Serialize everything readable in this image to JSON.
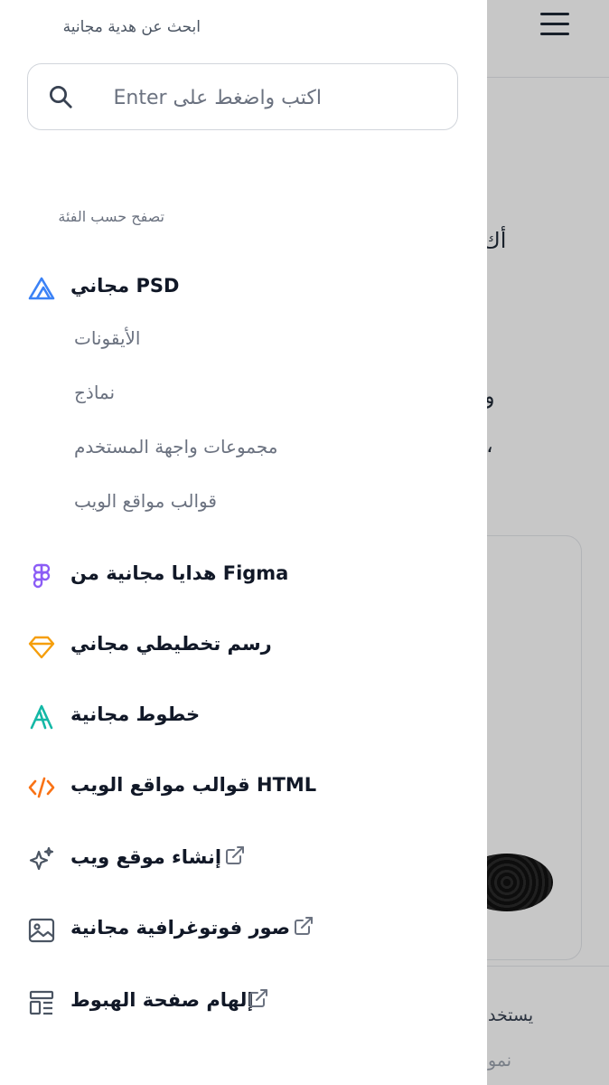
{
  "background": {
    "menu_label": "menu",
    "text_1": "أك",
    "text_2": "و",
    "text_3": "،",
    "footer_text_1": "يستخد",
    "footer_text_2": "نمو"
  },
  "drawer": {
    "title": "ابحث عن هدية مجانية",
    "search": {
      "placeholder": "اكتب واضغط على Enter",
      "value": ""
    },
    "section_label": "تصفح حسب الفئة",
    "categories": [
      {
        "label": "مجاني PSD",
        "icon": "psd-triangle-icon",
        "color": "#3b82f6",
        "external": false
      },
      {
        "label": "هدايا مجانية من Figma",
        "icon": "figma-icon",
        "color": "#8b5cf6",
        "external": false
      },
      {
        "label": "رسم تخطيطي مجاني",
        "icon": "sketch-diamond-icon",
        "color": "#f59e0b",
        "external": false
      },
      {
        "label": "خطوط مجانية",
        "icon": "font-a-icon",
        "color": "#14b8a6",
        "external": false
      },
      {
        "label": "قوالب مواقع الويب HTML",
        "icon": "code-icon",
        "color": "#f97316",
        "external": false
      },
      {
        "label": "إنشاء موقع ويب",
        "icon": "sparkles-icon",
        "color": "#4b5563",
        "external": true
      },
      {
        "label": "صور فوتوغرافية مجانية",
        "icon": "image-icon",
        "color": "#4b5563",
        "external": true
      },
      {
        "label": "إلهام صفحة الهبوط",
        "icon": "layout-icon",
        "color": "#4b5563",
        "external": true
      }
    ],
    "psd_subcategories": [
      "الأيقونات",
      "نماذج",
      "مجموعات واجهة المستخدم",
      "قوالب مواقع الويب"
    ]
  }
}
